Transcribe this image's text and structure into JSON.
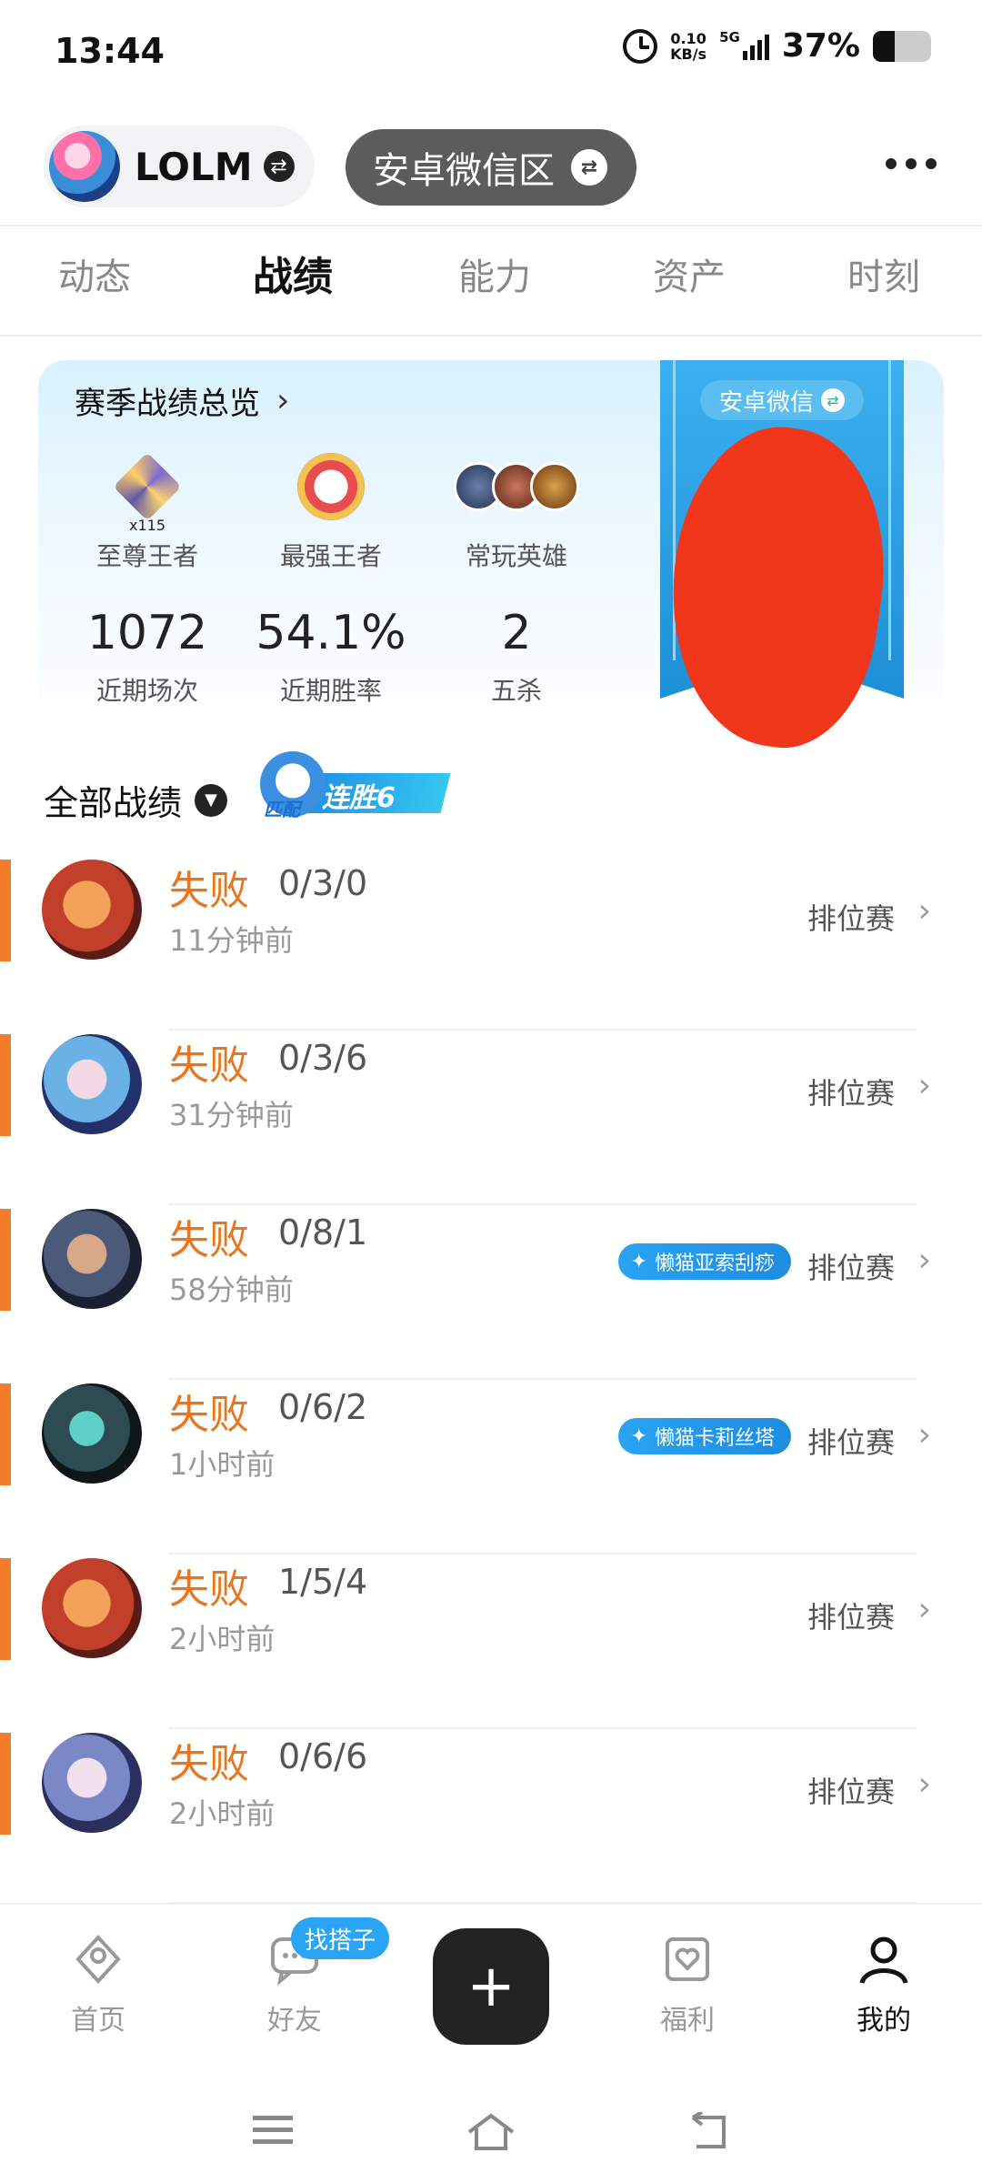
{
  "status_bar": {
    "time": "13:44",
    "net_speed_value": "0.10",
    "net_speed_unit": "KB/s",
    "network": "5G",
    "battery_percent": "37%",
    "battery_level": 0.37
  },
  "header": {
    "game_name": "LOLM",
    "region": "安卓微信区",
    "swap_icon": "⇄"
  },
  "tabs": [
    "动态",
    "战绩",
    "能力",
    "资产",
    "时刻"
  ],
  "active_tab": "战绩",
  "season": {
    "title": "赛季战绩总览",
    "rank_current": "至尊王者",
    "rank_multiplier": "x115",
    "rank_best": "最强王者",
    "heroes_label": "常玩英雄",
    "games_value": "1072",
    "games_label": "近期场次",
    "winrate_value": "54.1%",
    "winrate_label": "近期胜率",
    "pentakill_value": "2",
    "pentakill_label": "五杀",
    "banner_tag": "安卓微信"
  },
  "records": {
    "title": "全部战绩",
    "streak_mode": "匹配",
    "streak_text": "连胜6"
  },
  "matches": [
    {
      "result": "失败",
      "kda": "0/3/0",
      "time": "11分钟前",
      "mode": "排位赛",
      "tag": ""
    },
    {
      "result": "失败",
      "kda": "0/3/6",
      "time": "31分钟前",
      "mode": "排位赛",
      "tag": ""
    },
    {
      "result": "失败",
      "kda": "0/8/1",
      "time": "58分钟前",
      "mode": "排位赛",
      "tag": "懒猫亚索刮痧"
    },
    {
      "result": "失败",
      "kda": "0/6/2",
      "time": "1小时前",
      "mode": "排位赛",
      "tag": "懒猫卡莉丝塔"
    },
    {
      "result": "失败",
      "kda": "1/5/4",
      "time": "2小时前",
      "mode": "排位赛",
      "tag": ""
    },
    {
      "result": "失败",
      "kda": "0/6/6",
      "time": "2小时前",
      "mode": "排位赛",
      "tag": ""
    }
  ],
  "bottom_nav": {
    "home": "首页",
    "friends": "好友",
    "friends_badge": "找搭子",
    "plus": "+",
    "welfare": "福利",
    "mine": "我的",
    "active": "我的"
  },
  "colors": {
    "accent_orange": "#f47b29",
    "loss_text": "#e8761f",
    "tag_blue": "#1f8ce0"
  }
}
